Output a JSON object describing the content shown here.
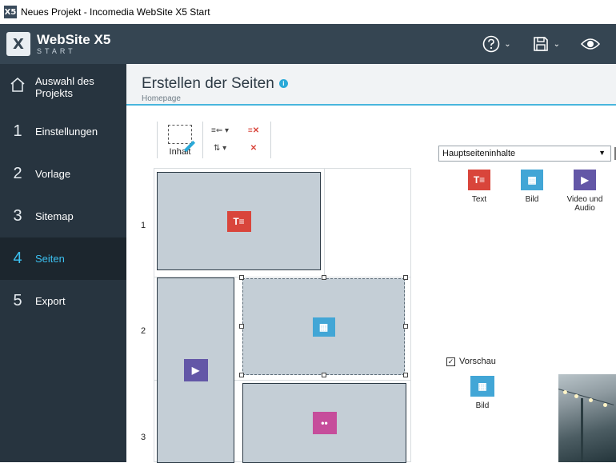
{
  "window": {
    "title": "Neues Projekt - Incomedia WebSite X5 Start"
  },
  "logo": {
    "name": "WebSite X5",
    "edition": "START"
  },
  "colors": {
    "topbar": "#354552",
    "sidebar": "#27343f",
    "accent": "#2aa9d8",
    "text_obj": "#d9453b",
    "image_obj": "#42a6d6",
    "video_obj": "#6357a7",
    "slideshow_obj": "#c64d9b"
  },
  "sidebar": {
    "items": [
      {
        "num": "",
        "label": "Auswahl des Projekts",
        "icon": "home-icon"
      },
      {
        "num": "1",
        "label": "Einstellungen"
      },
      {
        "num": "2",
        "label": "Vorlage"
      },
      {
        "num": "3",
        "label": "Sitemap"
      },
      {
        "num": "4",
        "label": "Seiten",
        "active": true
      },
      {
        "num": "5",
        "label": "Export"
      }
    ]
  },
  "header": {
    "title": "Erstellen der Seiten",
    "breadcrumb": "Homepage"
  },
  "toolbar": {
    "content_label": "Inhalt"
  },
  "grid": {
    "rows": [
      "1",
      "2",
      "3"
    ]
  },
  "objects_panel": {
    "dropdown_value": "Hauptseiteninhalte",
    "items": [
      {
        "label": "Text",
        "icon": "text-object-icon"
      },
      {
        "label": "Bild",
        "icon": "image-object-icon"
      },
      {
        "label": "Video und Audio",
        "icon": "video-audio-object-icon"
      }
    ]
  },
  "preview": {
    "checkbox_label": "Vorschau",
    "object_label": "Bild"
  }
}
